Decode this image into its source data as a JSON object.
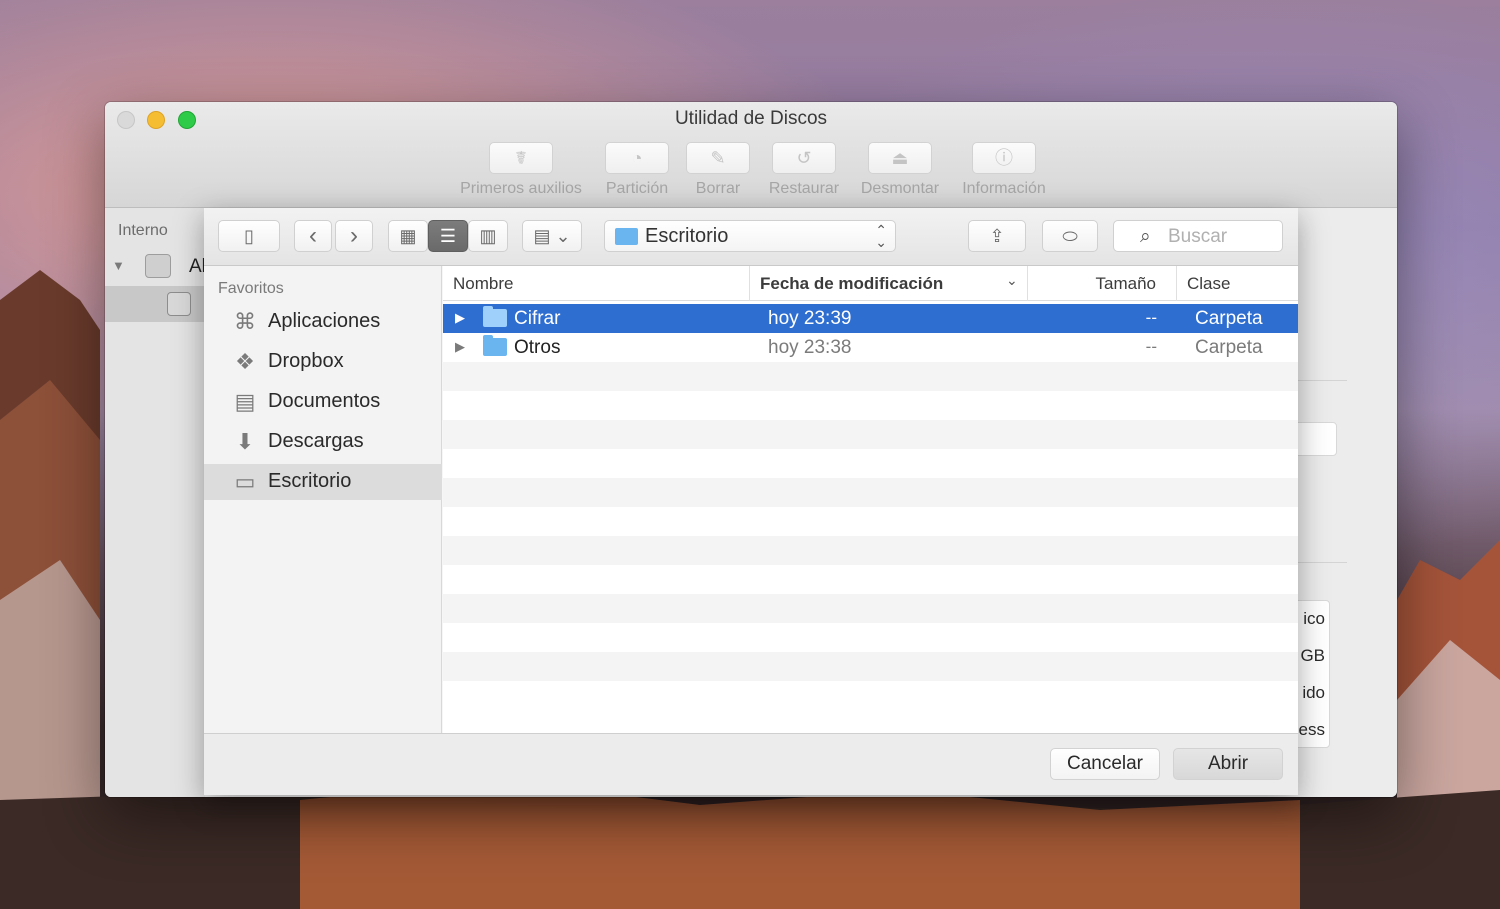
{
  "window": {
    "title": "Utilidad de Discos",
    "toolbar": [
      {
        "label": "Primeros auxilios",
        "icon": "stethoscope-icon",
        "glyph": "☤"
      },
      {
        "label": "Partición",
        "icon": "pie-chart-icon",
        "glyph": "◔"
      },
      {
        "label": "Borrar",
        "icon": "erase-icon",
        "glyph": "✎"
      },
      {
        "label": "Restaurar",
        "icon": "restore-icon",
        "glyph": "↺"
      },
      {
        "label": "Desmontar",
        "icon": "eject-icon",
        "glyph": "⏏"
      },
      {
        "label": "Información",
        "icon": "info-icon",
        "glyph": "ⓘ"
      }
    ],
    "sidebar": {
      "heading": "Interno",
      "disk_label": "Al"
    },
    "info_values": [
      "ico",
      "GB",
      "ido",
      "ess"
    ]
  },
  "dialog": {
    "toolbar": {
      "sidebar_toggle_glyph": "▯",
      "back_glyph": "‹",
      "forward_glyph": "›",
      "icon_view_glyph": "▦",
      "list_view_glyph": "☰",
      "column_view_glyph": "▥",
      "group_glyph": "▤ ⌄",
      "path": "Escritorio",
      "share_glyph": "⇪",
      "tag_glyph": "⬭",
      "search_placeholder": "Buscar",
      "search_glyph": "⌕"
    },
    "sidebar": {
      "heading": "Favoritos",
      "items": [
        {
          "label": "Aplicaciones",
          "icon": "applications-icon",
          "glyph": "⌘"
        },
        {
          "label": "Dropbox",
          "icon": "dropbox-icon",
          "glyph": "❖"
        },
        {
          "label": "Documentos",
          "icon": "documents-icon",
          "glyph": "▤"
        },
        {
          "label": "Descargas",
          "icon": "downloads-icon",
          "glyph": "⬇"
        },
        {
          "label": "Escritorio",
          "icon": "desktop-icon",
          "glyph": "▭",
          "selected": true
        }
      ]
    },
    "columns": {
      "name": "Nombre",
      "date": "Fecha de modificación",
      "size": "Tamaño",
      "kind": "Clase"
    },
    "files": [
      {
        "name": "Cifrar",
        "date": "hoy 23:39",
        "size": "--",
        "kind": "Carpeta",
        "selected": true
      },
      {
        "name": "Otros",
        "date": "hoy 23:38",
        "size": "--",
        "kind": "Carpeta",
        "selected": false
      }
    ],
    "buttons": {
      "cancel": "Cancelar",
      "open": "Abrir"
    }
  }
}
